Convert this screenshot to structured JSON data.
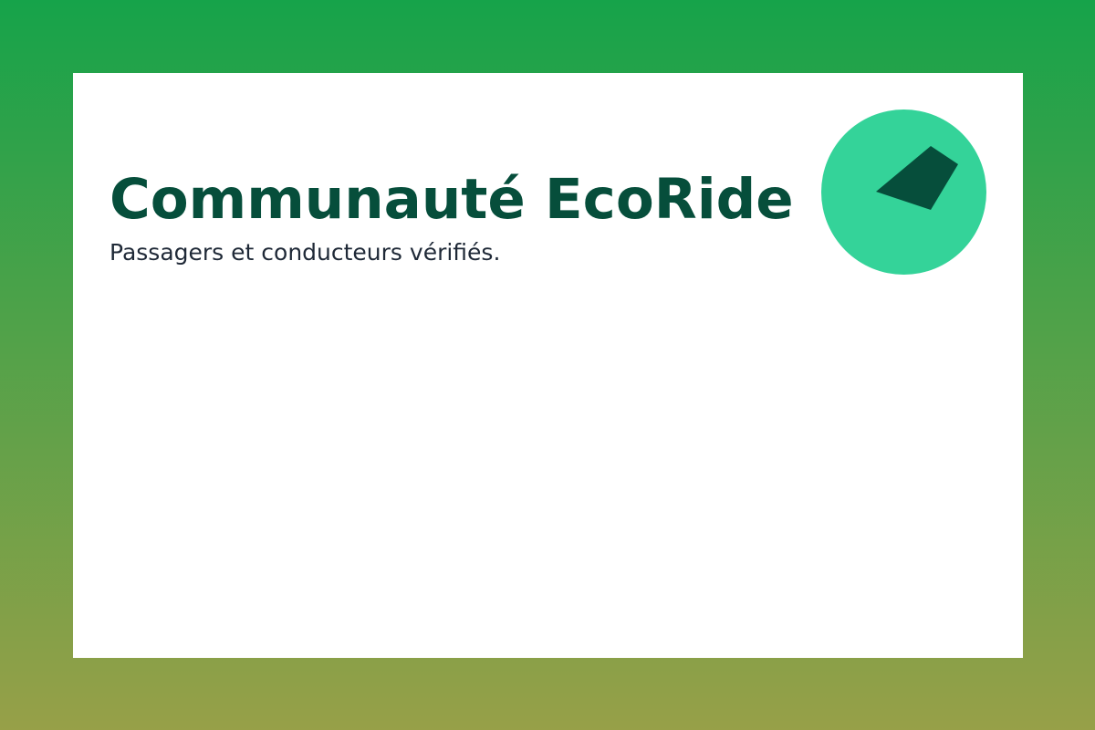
{
  "page": {
    "title": "Communauté EcoRide",
    "subtitle": "Passagers et conducteurs vérifiés."
  },
  "logo": {
    "icon": "leaf-arrow-icon"
  },
  "colors": {
    "background_top": "#16a34a",
    "background_bottom": "#97a048",
    "card": "#ffffff",
    "title": "#064e3b",
    "subtitle": "#1f2937",
    "logo_circle": "#34d399",
    "logo_mark": "#064e3b"
  }
}
